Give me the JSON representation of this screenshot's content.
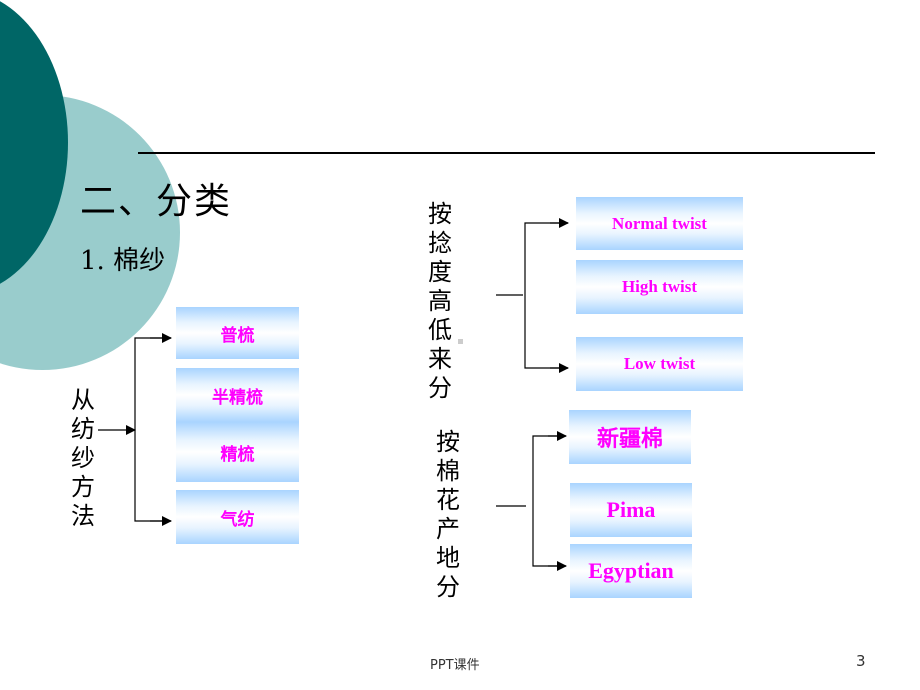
{
  "slide": {
    "heading": "二、分类",
    "subheading": "1. 棉纱",
    "footer": "PPT课件",
    "page_number": "3",
    "accent_colors": {
      "dark_teal": "#006666",
      "light_teal": "#99cccc",
      "box_text": "#ff00ff"
    }
  },
  "group1": {
    "label": "从纺纱方法",
    "items": [
      "普梳",
      "半精梳",
      "精梳",
      "气纺"
    ]
  },
  "group2": {
    "label": "按捻度高低来分",
    "items": [
      "Normal twist",
      "High twist",
      "Low twist"
    ]
  },
  "group3": {
    "label": "按棉花产地分",
    "items": [
      "新疆棉",
      "Pima",
      "Egyptian"
    ]
  }
}
